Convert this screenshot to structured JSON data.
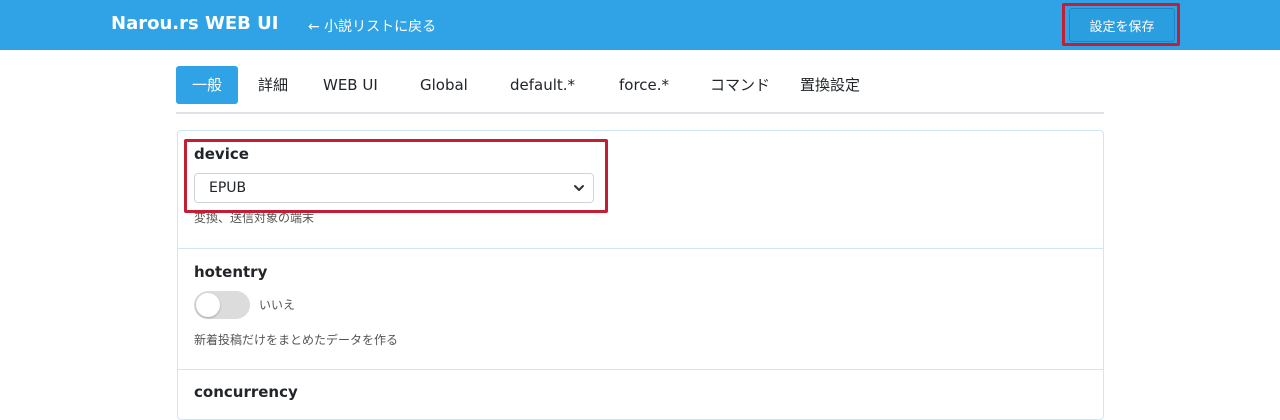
{
  "header": {
    "brand": "Narou.rs WEB UI",
    "back_link": "← 小説リストに戻る",
    "save_label": "設定を保存"
  },
  "tabs": [
    {
      "label": "一般",
      "active": true
    },
    {
      "label": "詳細"
    },
    {
      "label": "WEB UI"
    },
    {
      "label": "Global"
    },
    {
      "label": "default.*"
    },
    {
      "label": "force.*"
    },
    {
      "label": "コマンド"
    },
    {
      "label": "置換設定"
    }
  ],
  "settings": {
    "device": {
      "label": "device",
      "selected": "EPUB",
      "help": "変換、送信対象の端末"
    },
    "hotentry": {
      "label": "hotentry",
      "toggle_state": "いいえ",
      "enabled": false,
      "help": "新着投稿だけをまとめたデータを作る"
    },
    "concurrency": {
      "label": "concurrency"
    }
  },
  "colors": {
    "accent": "#2fa3e6",
    "highlight": "#c21f32"
  },
  "icons": {
    "select_caret": "chevron-down-icon"
  }
}
